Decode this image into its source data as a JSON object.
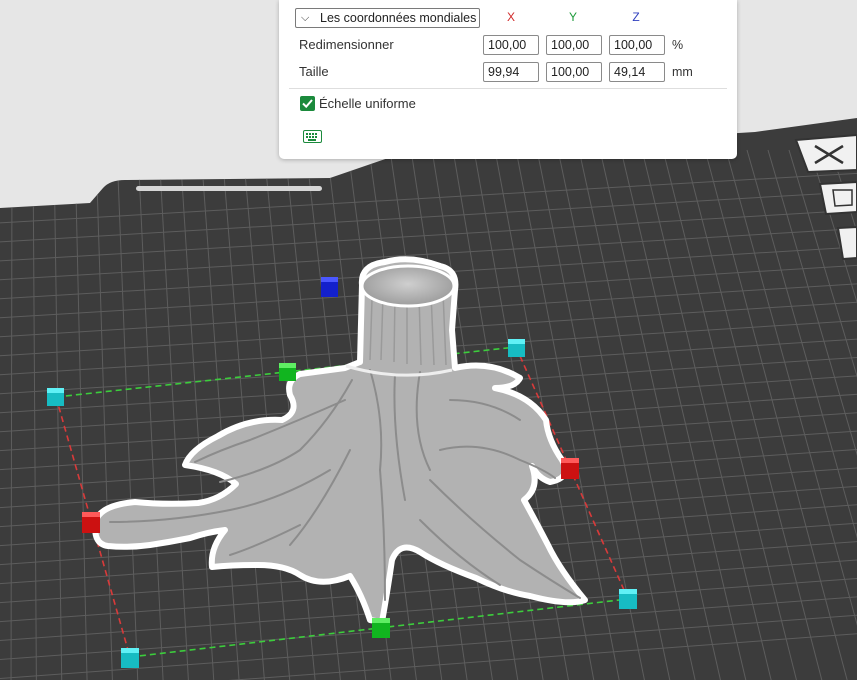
{
  "transform_panel": {
    "coordinate_system": "Les coordonnées mondiales",
    "axes": {
      "x": "X",
      "y": "Y",
      "z": "Z"
    },
    "axis_colors": {
      "x": "#d12a2a",
      "y": "#1d9a3a",
      "z": "#2f3fbf"
    },
    "rows": {
      "scale": {
        "label": "Redimensionner",
        "x": "100,00",
        "y": "100,00",
        "z": "100,00",
        "unit": "%"
      },
      "size": {
        "label": "Taille",
        "x": "99,94",
        "y": "100,00",
        "z": "49,14",
        "unit": "mm"
      }
    },
    "uniform_scale": {
      "label": "Échelle uniforme",
      "checked": true
    }
  },
  "icons": {
    "coord_dropdown": "chevron-down-icon",
    "uniform_checkbox": "checkmark-icon",
    "keyboard": "keyboard-icon",
    "side_buttons": [
      "close-icon",
      "auto-orient-icon",
      "arrange-icon"
    ]
  },
  "colors": {
    "plate": "#3c3c3c",
    "grid": "#5f5f5f",
    "model": "#b3b3b3",
    "outline": "#ffffff",
    "handle_scale_x": "#cc1111",
    "handle_scale_y": "#11b51f",
    "handle_corner": "#1fc7cf",
    "handle_z": "#1320cc",
    "accent": "#1b8a3c"
  }
}
